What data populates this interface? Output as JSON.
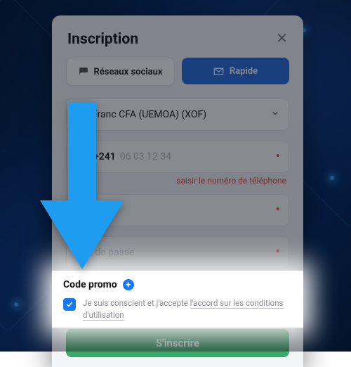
{
  "header": {
    "title": "Inscription"
  },
  "tabs": {
    "social_label": "Réseaux sociaux",
    "rapid_label": "Rapide"
  },
  "currency": {
    "label": "Franc CFA (UEMOA) (XOF)"
  },
  "phone": {
    "prefix": "+241",
    "placeholder": "06 03 12 34",
    "error": "saisir le numéro de téléphone"
  },
  "password": {
    "placeholder": "Mot de passe"
  },
  "promo": {
    "label": "Code promo"
  },
  "terms": {
    "prefix_text": "Je suis conscient et j'accepte ",
    "link_text": "l'accord sur les conditions d'utilisation"
  },
  "submit": {
    "label": "S'inscrire"
  },
  "colors": {
    "accent": "#1677ff",
    "cta": "#2fa360",
    "tab_active": "#2f6fe0",
    "error": "#e04848"
  },
  "icons": {
    "close": "close-icon",
    "comment": "comment-icon",
    "envelope": "envelope-icon",
    "chevron": "chevron-down-icon",
    "plus": "plus-icon",
    "check": "check-icon",
    "flag": "gabon-flag-icon"
  }
}
